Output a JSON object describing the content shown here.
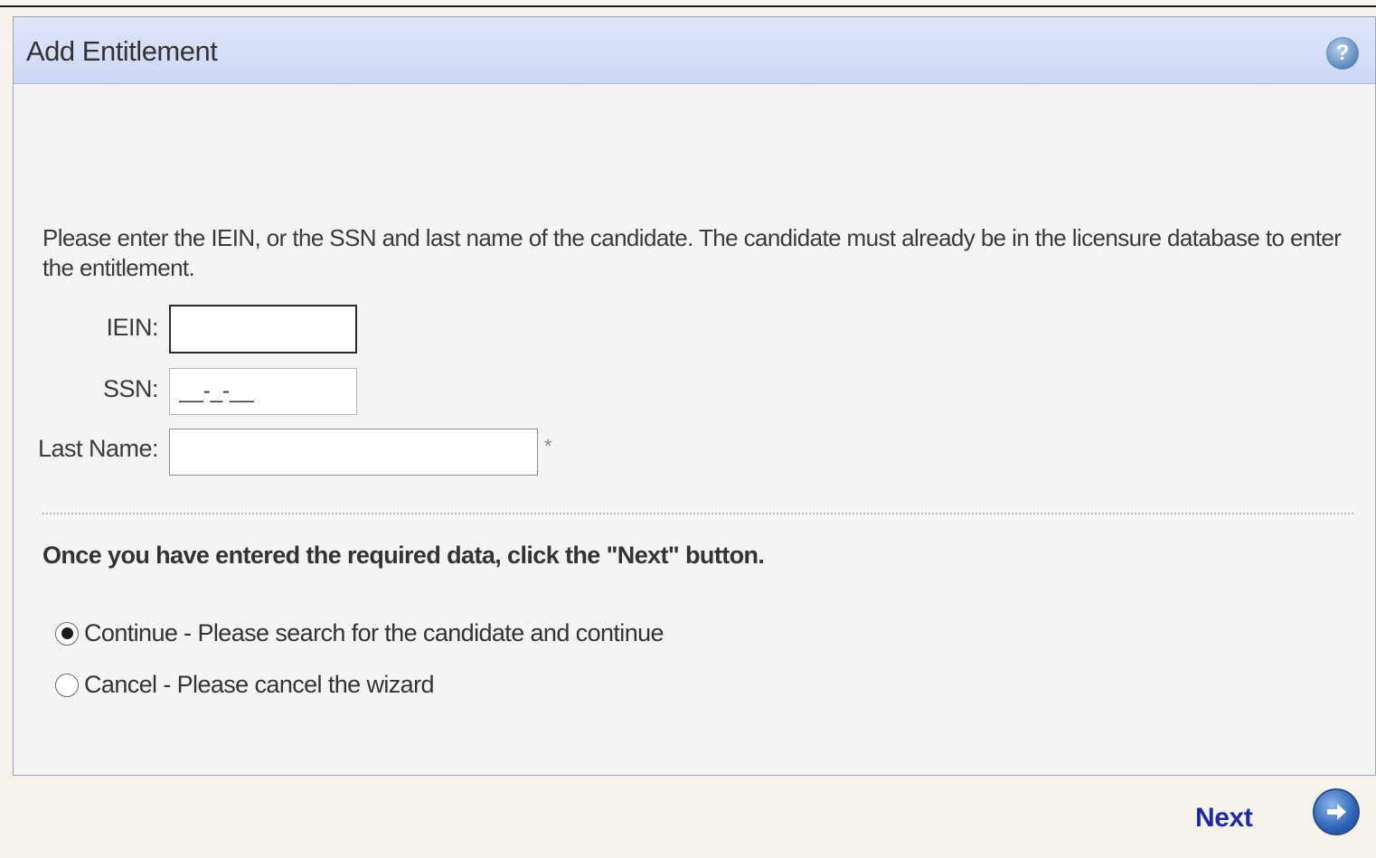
{
  "panel": {
    "title": "Add Entitlement",
    "help_icon": "help-icon"
  },
  "intro_text": "Please enter the IEIN, or the SSN and last name of the candidate. The candidate must already be in the licensure database to enter the entitlement.",
  "form": {
    "iein_label": "IEIN:",
    "iein_value": "",
    "ssn_label": "SSN:",
    "ssn_value": "__-_-__",
    "last_name_label": "Last Name:",
    "last_name_value": "",
    "required_marker": "*"
  },
  "instruction": "Once you have entered the required data, click the \"Next\" button.",
  "options": [
    {
      "label": "Continue - Please search for the candidate and continue",
      "selected": true
    },
    {
      "label": "Cancel - Please cancel the wizard",
      "selected": false
    }
  ],
  "footer": {
    "next_label": "Next",
    "next_icon": "arrow-right-circle-icon"
  },
  "colors": {
    "header_bg": "#d6dff8",
    "next_link": "#1d2aa3",
    "panel_bg": "#f4f4f4"
  }
}
